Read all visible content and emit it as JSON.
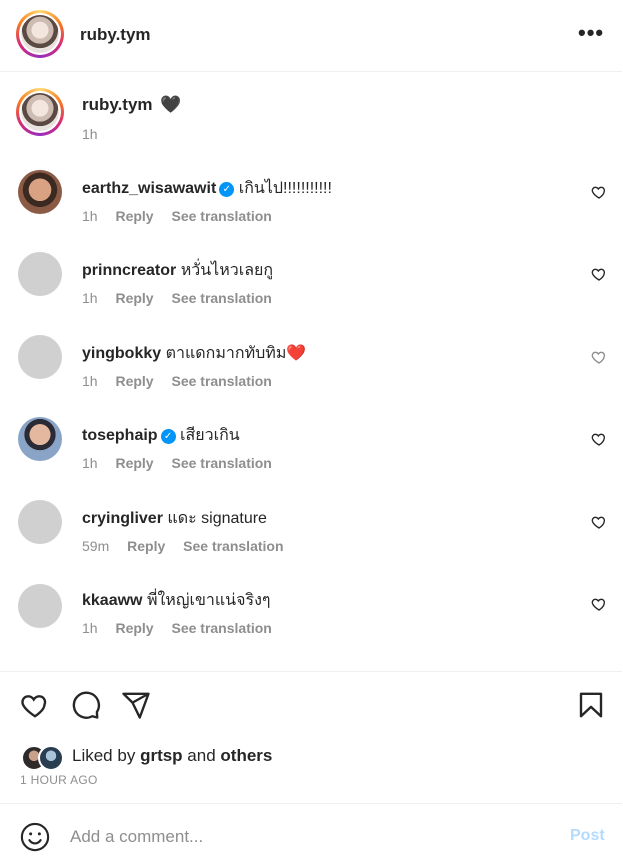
{
  "header": {
    "username": "ruby.tym",
    "more_label": "•••"
  },
  "caption": {
    "username": "ruby.tym",
    "emoji": "🖤",
    "time": "1h"
  },
  "comments": [
    {
      "username": "earthz_wisawawit",
      "verified": true,
      "text": "เกินไป!!!!!!!!!!!",
      "time": "1h",
      "reply": "Reply",
      "translate": "See translation"
    },
    {
      "username": "prinncreator",
      "verified": false,
      "text": "หวั่นไหวเลยกู",
      "time": "1h",
      "reply": "Reply",
      "translate": "See translation"
    },
    {
      "username": "yingbokky",
      "verified": false,
      "text": "ตาแดกมากทับทิม",
      "emoji": "❤️",
      "time": "1h",
      "reply": "Reply",
      "translate": "See translation"
    },
    {
      "username": "tosephaip",
      "verified": true,
      "text": "เสียวเกิน",
      "time": "1h",
      "reply": "Reply",
      "translate": "See translation"
    },
    {
      "username": "cryingliver",
      "verified": false,
      "text": "แดะ signature",
      "time": "59m",
      "reply": "Reply",
      "translate": "See translation"
    },
    {
      "username": "kkaaww",
      "verified": false,
      "text": "พี่ใหญ่เขาแน่จริงๆ",
      "time": "1h",
      "reply": "Reply",
      "translate": "See translation"
    }
  ],
  "likes": {
    "prefix": "Liked by",
    "user": "grtsp",
    "middle": "and",
    "others": "others"
  },
  "post_time": "1 HOUR AGO",
  "add_comment": {
    "placeholder": "Add a comment...",
    "post_label": "Post"
  },
  "colors": {
    "accent": "#0095f6",
    "post_disabled": "#b3dbff",
    "muted": "#8e8e8e"
  }
}
